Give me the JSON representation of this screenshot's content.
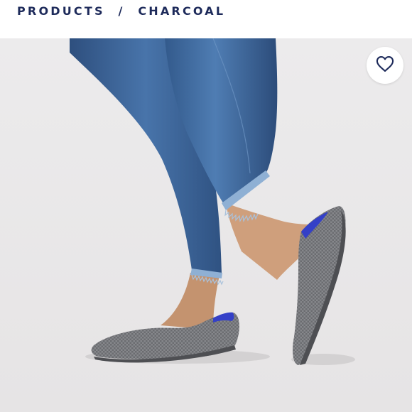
{
  "breadcrumb": {
    "parent": "PRODUCTS",
    "separator": "/",
    "current": "CHARCOAL"
  },
  "product_image": {
    "subject": "charcoal knit pointed-toe flats worn with cropped blue denim jeans",
    "background_color": "#eceaeb"
  },
  "favorite_button": {
    "icon": "heart-outline-icon"
  },
  "colors": {
    "breadcrumb_text": "#1d2a5a",
    "denim": "#3a5f92",
    "shoe_knit": "#7a7b7f",
    "shoe_lining": "#3440c8",
    "skin": "#c99a78"
  }
}
